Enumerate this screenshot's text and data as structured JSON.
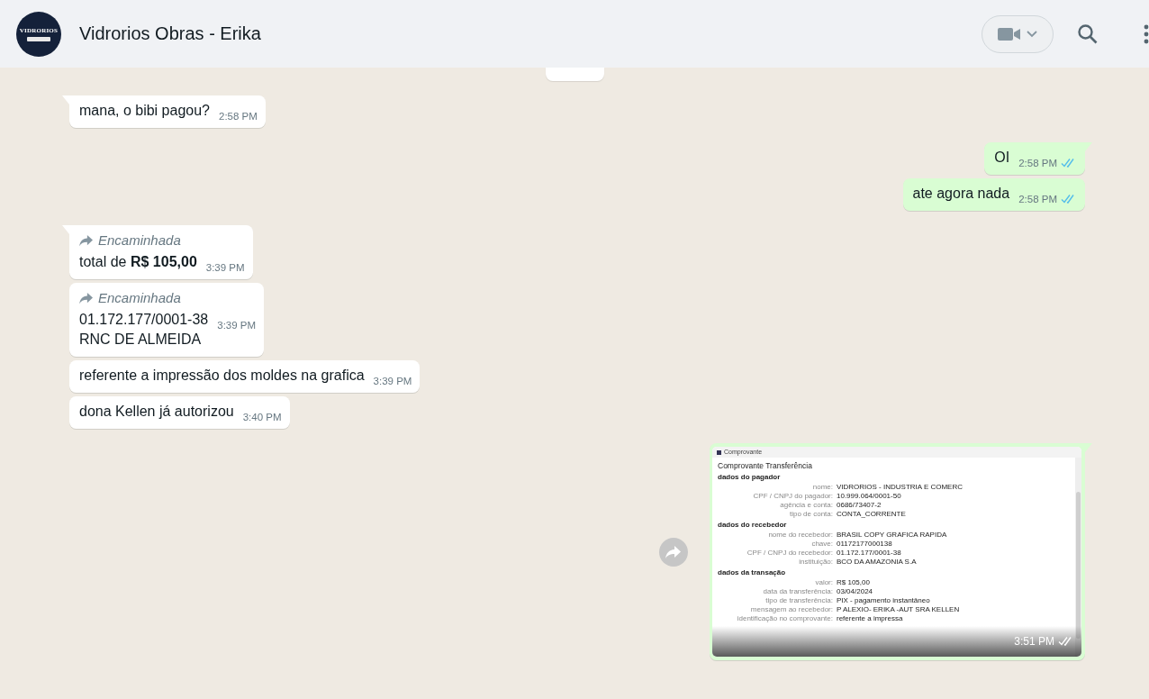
{
  "header": {
    "avatar_text": "VIDRORIOS",
    "title": "Vidrorios Obras - Erika"
  },
  "messages": [
    {
      "kind": "text",
      "outgoing": false,
      "tail": true,
      "text": "mana, o bibi pagou?",
      "time": "2:58 PM"
    },
    {
      "kind": "text",
      "outgoing": true,
      "tail": true,
      "read": true,
      "text": "OI",
      "time": "2:58 PM"
    },
    {
      "kind": "text",
      "outgoing": true,
      "tail": false,
      "read": true,
      "text": "ate agora nada",
      "time": "2:58 PM"
    },
    {
      "kind": "forwarded",
      "outgoing": false,
      "tail": true,
      "label": "Encaminhada",
      "text": "total de **R$ 105,00**",
      "time": "3:39 PM"
    },
    {
      "kind": "forwarded",
      "outgoing": false,
      "tail": false,
      "label": "Encaminhada",
      "text": "01.172.177/0001-38\nRNC DE ALMEIDA",
      "time": "3:39 PM"
    },
    {
      "kind": "text",
      "outgoing": false,
      "tail": false,
      "text": "referente a impressão dos moldes na grafica",
      "time": "3:39 PM"
    },
    {
      "kind": "text",
      "outgoing": false,
      "tail": false,
      "text": "dona Kellen já autorizou",
      "time": "3:40 PM"
    },
    {
      "kind": "image",
      "outgoing": true,
      "tail": true,
      "read": true,
      "time": "3:51 PM",
      "receipt": {
        "window_title": "Comprovante",
        "heading": "Comprovante Transferência",
        "sections": [
          {
            "title": "dados do pagador",
            "rows": [
              {
                "label": "nome:",
                "value": "VIDRORIOS - INDUSTRIA E COMERC"
              },
              {
                "label": "CPF / CNPJ do pagador:",
                "value": "10.999.064/0001-50"
              },
              {
                "label": "agência e conta:",
                "value": "0686/73407-2"
              },
              {
                "label": "tipo de conta:",
                "value": "CONTA_CORRENTE"
              }
            ]
          },
          {
            "title": "dados do recebedor",
            "rows": [
              {
                "label": "nome do recebedor:",
                "value": "BRASIL COPY GRAFICA RAPIDA"
              },
              {
                "label": "chave:",
                "value": "01172177000138"
              },
              {
                "label": "CPF / CNPJ do recebedor:",
                "value": "01.172.177/0001-38"
              },
              {
                "label": "instituição:",
                "value": "BCO DA AMAZONIA S.A"
              }
            ]
          },
          {
            "title": "dados da transação",
            "rows": [
              {
                "label": "valor:",
                "value": "R$ 105,00"
              },
              {
                "label": "data da transferência:",
                "value": "03/04/2024"
              },
              {
                "label": "tipo de transferência:",
                "value": "PIX - pagamento instantâneo"
              },
              {
                "label": "mensagem ao recebedor:",
                "value": "P ALEXIO- ERIKA -AUT SRA KELLEN"
              },
              {
                "label": "identificação no comprovante:",
                "value": "referente a impressa"
              }
            ]
          }
        ]
      }
    }
  ]
}
